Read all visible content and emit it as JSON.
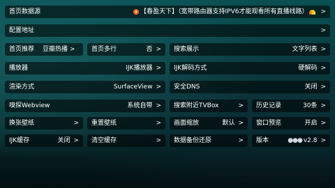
{
  "rows": [
    {
      "label": "首页数据源",
      "value": "【春盈天下】（宽带路由器支持IPV6才能观看所有直播线路）"
    },
    {
      "label": "配置地址",
      "value": ""
    },
    {
      "label": "首页推荐",
      "mid": "豆瓣热播 >",
      "value": ""
    },
    {
      "label": "首页多行",
      "value": "否"
    },
    {
      "label": "搜索展示",
      "value": "文字列表"
    },
    {
      "label": "播放器",
      "value": "IJK播放器"
    },
    {
      "label": "IJK解码方式",
      "value": "硬解码"
    },
    {
      "label": "渲染方式",
      "value": "SurfaceView"
    },
    {
      "label": "安全DNS",
      "value": "关闭"
    },
    {
      "label": "嗅探Webview",
      "value": "系统自带"
    },
    {
      "label": "搜索附近TVBox",
      "value": ""
    },
    {
      "label": "历史记录",
      "value": "30条"
    },
    {
      "label": "换张壁纸",
      "value": ""
    },
    {
      "label": "重置壁纸",
      "value": ""
    },
    {
      "label": "画面缩放",
      "value": "默认"
    },
    {
      "label": "窗口预览",
      "value": "开启"
    },
    {
      "label": "IJK缓存",
      "value": "关闭"
    },
    {
      "label": "清空缓存",
      "value": ""
    },
    {
      "label": "数据备份还原",
      "value": ""
    },
    {
      "label": "版本",
      "value": "v2.8"
    }
  ],
  "arrow": ">",
  "icons": {
    "source_left": "gear-icon",
    "source_rainbow": "rainbow-icon",
    "version": "dots-icon"
  }
}
